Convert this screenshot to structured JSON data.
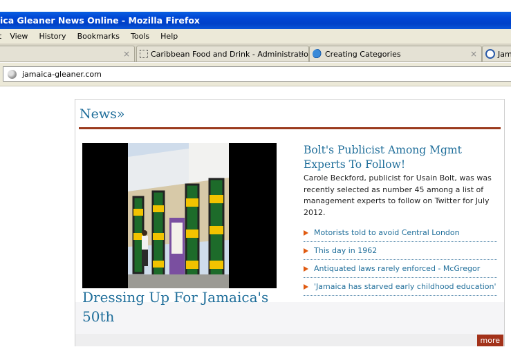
{
  "window": {
    "title": "ica Gleaner News Online - Mozilla Firefox"
  },
  "menubar": {
    "items": [
      "t",
      "View",
      "History",
      "Bookmarks",
      "Tools",
      "Help"
    ]
  },
  "tabs": [
    {
      "label": "",
      "icon": "none",
      "close": "×"
    },
    {
      "label": "Caribbean Food and Drink - Administration",
      "icon": "blank-page-icon",
      "close": "×"
    },
    {
      "label": "Creating Categories",
      "icon": "cloud-icon",
      "close": "×"
    },
    {
      "label": "Jam",
      "icon": "gleaner-icon",
      "close": ""
    }
  ],
  "addressbar": {
    "url": "jamaica-gleaner.com"
  },
  "news": {
    "heading": "News»",
    "hero_caption": "Dressing Up For Jamaica's 50th",
    "story_headline": "Bolt's Publicist Among Mgmt Experts To Follow!",
    "story_summary": "Carole Beckford, publicist for Usain Bolt, was was recently selected as number 45 among a list of management experts to follow on Twitter for July 2012.",
    "links": [
      "Motorists told to avoid Central London",
      "This day in 1962",
      "Antiquated laws rarely enforced - McGregor",
      "'Jamaica has starved early childhood education'"
    ],
    "more_label": "more"
  },
  "colors": {
    "titlebar": "#0046d5",
    "link_blue": "#1f6e9a",
    "rule_red": "#9b3a1d",
    "arrow_orange": "#e05a10",
    "more_bg": "#a3321a"
  }
}
